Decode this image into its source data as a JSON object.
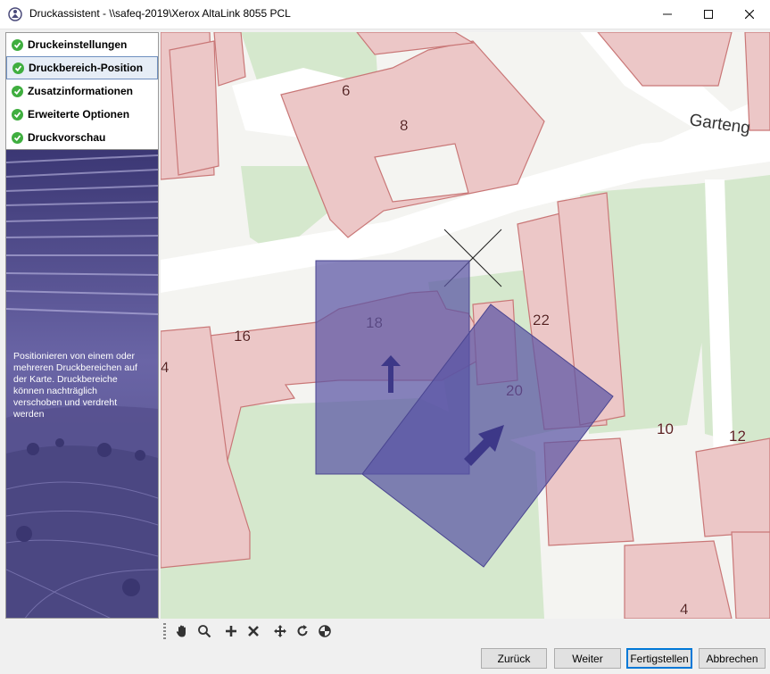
{
  "window": {
    "title": "Druckassistent - \\\\safeq-2019\\Xerox AltaLink 8055 PCL"
  },
  "steps": [
    {
      "label": "Druckeinstellungen",
      "done": true,
      "active": false
    },
    {
      "label": "Druckbereich-Position",
      "done": true,
      "active": true
    },
    {
      "label": "Zusatzinformationen",
      "done": true,
      "active": false
    },
    {
      "label": "Erweiterte Optionen",
      "done": true,
      "active": false
    },
    {
      "label": "Druckvorschau",
      "done": true,
      "active": false
    }
  ],
  "sidebar": {
    "info_text": "Positionieren von einem oder mehreren Druckbereichen auf der Karte. Druckbereiche können nachträglich verschoben und verdreht werden",
    "help_label": "?"
  },
  "map": {
    "street_label": "Garteng",
    "house_numbers": [
      "6",
      "8",
      "16",
      "18",
      "22",
      "20",
      "10",
      "12",
      "4",
      "4"
    ],
    "colors": {
      "building_fill": "#ecc7c7",
      "building_stroke": "#c97777",
      "green_area": "#d5e8cd",
      "street": "#ffffff",
      "print_area": "#5a55a5"
    }
  },
  "toolbar": {
    "tools": [
      "hand-pan-icon",
      "zoom-icon",
      "add-area-icon",
      "delete-area-icon",
      "move-icon",
      "rotate-icon",
      "center-icon"
    ]
  },
  "buttons": {
    "back": "Zurück",
    "next": "Weiter",
    "finish": "Fertigstellen",
    "cancel": "Abbrechen"
  }
}
